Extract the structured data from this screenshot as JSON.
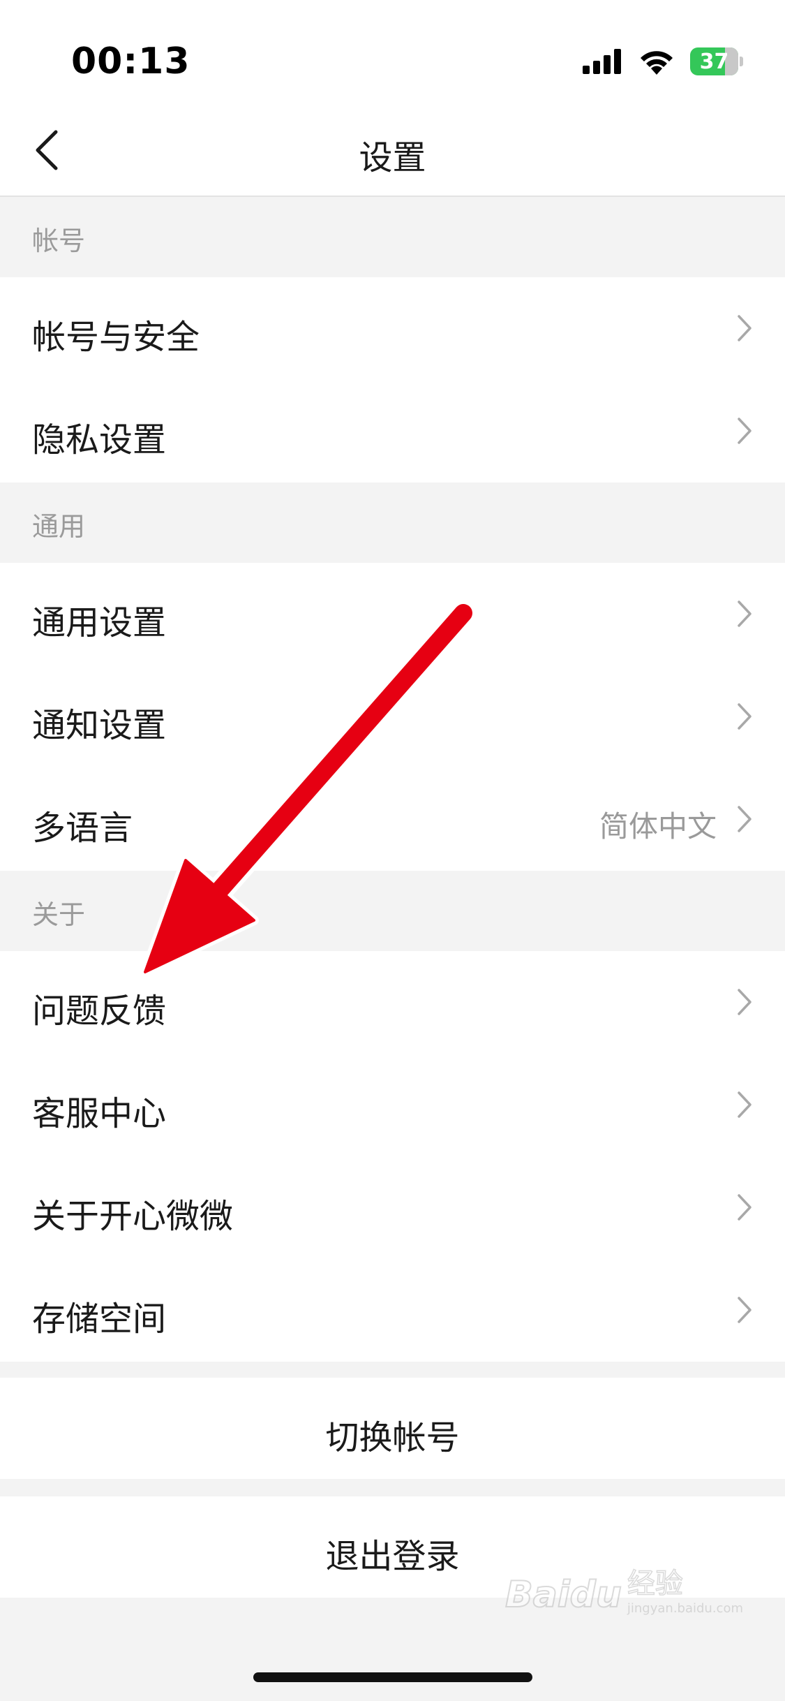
{
  "status_bar": {
    "time": "00:13",
    "battery_level": "37"
  },
  "nav": {
    "title": "设置"
  },
  "sections": [
    {
      "header": "帐号",
      "items": [
        {
          "label": "帐号与安全",
          "value": ""
        },
        {
          "label": "隐私设置",
          "value": ""
        }
      ]
    },
    {
      "header": "通用",
      "items": [
        {
          "label": "通用设置",
          "value": ""
        },
        {
          "label": "通知设置",
          "value": ""
        },
        {
          "label": "多语言",
          "value": "简体中文"
        }
      ]
    },
    {
      "header": "关于",
      "items": [
        {
          "label": "问题反馈",
          "value": ""
        },
        {
          "label": "客服中心",
          "value": ""
        },
        {
          "label": "关于开心微微",
          "value": ""
        },
        {
          "label": "存储空间",
          "value": ""
        }
      ]
    }
  ],
  "actions": {
    "switch_account": "切换帐号",
    "logout": "退出登录"
  },
  "watermark": {
    "logo": "Baidu",
    "text": "经验",
    "url": "jingyan.baidu.com"
  },
  "icons": {
    "back": "chevron-left-icon",
    "row_arrow": "chevron-right-icon",
    "annotation": "red-arrow-icon"
  },
  "colors": {
    "background": "#f3f3f3",
    "row_background": "#ffffff",
    "secondary_text": "#9a9a9a",
    "battery": "#34c759",
    "annotation_arrow": "#e60012"
  }
}
